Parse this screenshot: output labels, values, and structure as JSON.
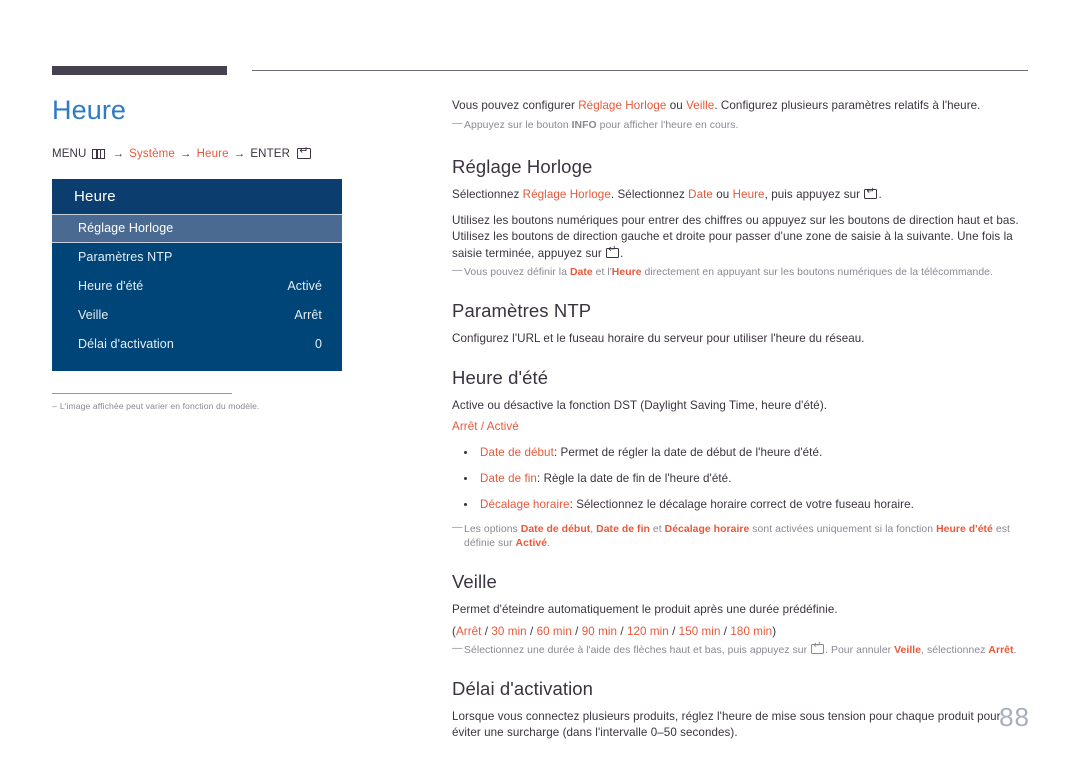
{
  "page": {
    "number": "88",
    "language": "fr"
  },
  "left": {
    "title": "Heure",
    "menu_path": {
      "menu_label": "MENU",
      "menu_icon": "menu-grid-icon",
      "arrow": "→",
      "step1": "Système",
      "step2": "Heure",
      "enter_label": "ENTER",
      "enter_icon": "enter-key-icon"
    },
    "osd": {
      "header": "Heure",
      "rows": [
        {
          "label": "Réglage Horloge",
          "value": "",
          "selected": true
        },
        {
          "label": "Paramètres NTP",
          "value": "",
          "selected": false
        },
        {
          "label": "Heure d'été",
          "value": "Activé",
          "selected": false
        },
        {
          "label": "Veille",
          "value": "Arrêt",
          "selected": false
        },
        {
          "label": "Délai d'activation",
          "value": "0",
          "selected": false
        }
      ]
    },
    "note": {
      "dash": "–",
      "text": "L'image affichée peut varier en fonction du modèle."
    }
  },
  "right": {
    "intro": {
      "t1": "Vous pouvez configurer ",
      "link1": "Réglage Horloge",
      "t2": " ou ",
      "link2": "Veille",
      "t3": ". Configurez plusieurs paramètres relatifs à l'heure."
    },
    "intro_note": {
      "t1": "Appuyez sur le bouton ",
      "b1": "INFO",
      "t2": " pour afficher l'heure en cours."
    },
    "sections": [
      {
        "heading": "Réglage Horloge",
        "p1": {
          "t1": "Sélectionnez ",
          "link1": "Réglage Horloge",
          "t2": ". Sélectionnez ",
          "link2": "Date",
          "t3": " ou ",
          "link3": "Heure",
          "t4": ", puis appuyez sur ",
          "icon": "enter-key-icon",
          "t5": "."
        },
        "p2": {
          "t1": "Utilisez les boutons numériques pour entrer des chiffres ou appuyez sur les boutons de direction haut et bas. Utilisez les boutons de direction gauche et droite pour passer d'une zone de saisie à la suivante. Une fois la saisie terminée, appuyez sur ",
          "icon": "enter-key-icon",
          "t2": "."
        },
        "note": {
          "t1": "Vous pouvez définir la ",
          "b1": "Date",
          "t2": " et l'",
          "b2": "Heure",
          "t3": " directement en appuyant sur les boutons numériques de la télécommande."
        }
      },
      {
        "heading": "Paramètres NTP",
        "p1_plain": "Configurez l'URL et le fuseau horaire du serveur pour utiliser l'heure du réseau."
      },
      {
        "heading": "Heure d'été",
        "p1_plain": "Active ou désactive la fonction DST (Daylight Saving Time, heure d'été).",
        "options": "Arrêt / Activé",
        "bullets": [
          {
            "term": "Date de début",
            "sep": ": ",
            "desc": "Permet de régler la date de début de l'heure d'été."
          },
          {
            "term": "Date de fin",
            "sep": ": ",
            "desc": "Règle la date de fin de l'heure d'été."
          },
          {
            "term": "Décalage horaire",
            "sep": ": ",
            "desc": "Sélectionnez le décalage horaire correct de votre fuseau horaire."
          }
        ],
        "note": {
          "t1": "Les options ",
          "b1": "Date de début",
          "t2": ", ",
          "b2": "Date de fin",
          "t3": " et ",
          "b3": "Décalage horaire",
          "t4": " sont activées uniquement si la fonction ",
          "b4": "Heure d'été",
          "t5": " est définie sur ",
          "b5": "Activé",
          "t6": "."
        }
      },
      {
        "heading": "Veille",
        "p1_plain": "Permet d'éteindre automatiquement le produit après une durée prédéfinie.",
        "options_list": {
          "open": "(",
          "items": [
            "Arrêt",
            "30 min",
            "60 min",
            "90 min",
            "120 min",
            "150 min",
            "180 min"
          ],
          "sep": " / ",
          "close": ")"
        },
        "note": {
          "t1": "Sélectionnez une durée à l'aide des flèches haut et bas, puis appuyez sur ",
          "icon": "enter-key-icon",
          "t2": ". Pour annuler ",
          "b1": "Veille",
          "t3": ", sélectionnez ",
          "b2": "Arrêt",
          "t4": "."
        }
      },
      {
        "heading": "Délai d'activation",
        "p1_plain": "Lorsque vous connectez plusieurs produits, réglez l'heure de mise sous tension pour chaque produit pour éviter une surcharge (dans l'intervalle 0–50 secondes)."
      }
    ]
  },
  "colors": {
    "accent_orange": "#e8583a",
    "title_blue": "#2e7bc4",
    "osd_header": "#0b3d6e",
    "osd_body": "#004578",
    "osd_selected": "#4a6a92",
    "heading": "#3b3340",
    "muted": "#8b8794",
    "rule_dark": "#46414f"
  }
}
